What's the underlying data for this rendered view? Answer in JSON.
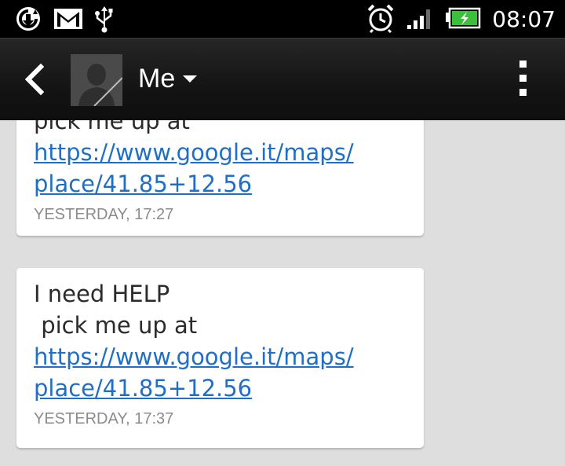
{
  "status_bar": {
    "time": "08:07",
    "left_icons": [
      "sync-icon",
      "gmail-icon",
      "usb-icon"
    ],
    "right_icons": [
      "alarm-icon",
      "signal-icon",
      "battery-charging-icon"
    ]
  },
  "action_bar": {
    "contact_name": "Me",
    "icons": [
      "back-icon",
      "avatar-icon",
      "dropdown-icon",
      "overflow-menu-icon"
    ]
  },
  "messages": [
    {
      "text_partial": "pick me up at",
      "link": "https://www.google.it/maps/\nplace/41.85+12.56",
      "timestamp": "YESTERDAY, 17:27"
    },
    {
      "text": "I need HELP\n pick me up at",
      "link": "https://www.google.it/maps/\nplace/41.85+12.56",
      "timestamp": "YESTERDAY, 17:37"
    }
  ],
  "colors": {
    "link": "#1f6fc6",
    "background": "#dedede",
    "timestamp": "#8c8c8c",
    "battery": "#3cc03c"
  }
}
